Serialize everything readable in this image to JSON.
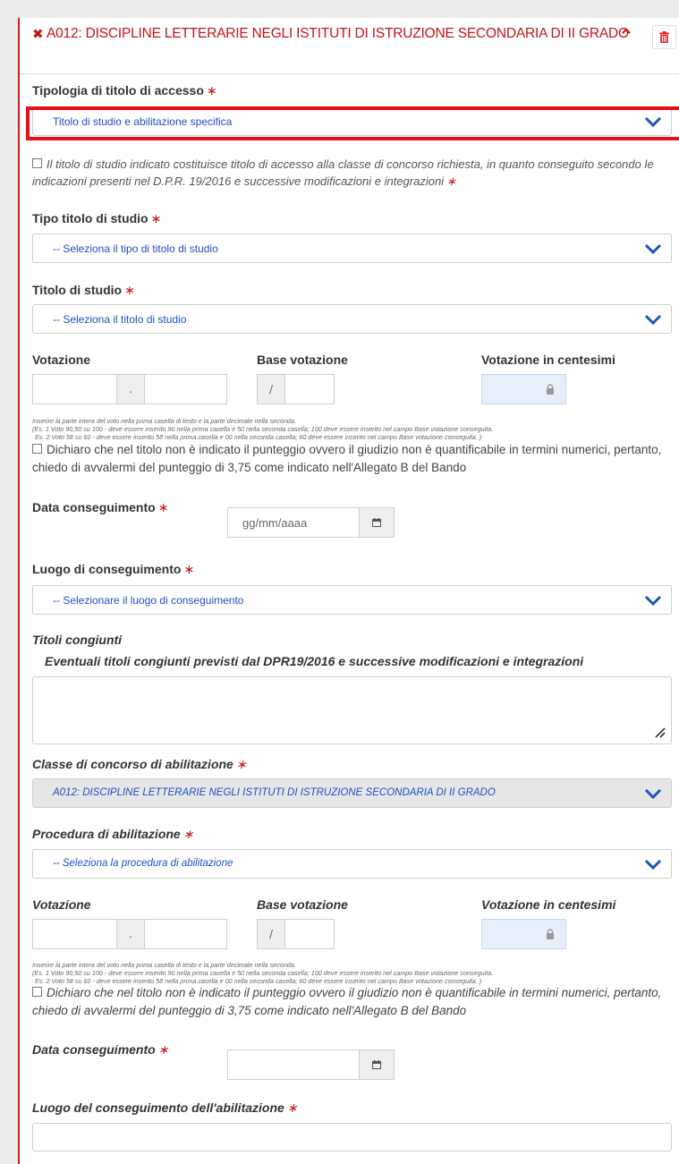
{
  "header": {
    "close_symbol": "✖",
    "title": "A012: DISCIPLINE LETTERARIE NEGLI ISTITUTI DI ISTRUZIONE SECONDARIA DI II GRADO"
  },
  "accesso": {
    "label": "Tipologia di titolo di accesso",
    "value": "Titolo di studio e abilitazione specifica"
  },
  "check1": "Il titolo di studio indicato costituisce titolo di accesso alla classe di concorso richiesta, in quanto conseguito secondo le indicazioni presenti nel D.P.R. 19/2016 e successive modificazioni e integrazioni",
  "tipo_titolo": {
    "label": "Tipo titolo di studio",
    "value": "-- Seleziona il tipo di titolo di studio"
  },
  "titolo": {
    "label": "Titolo di studio",
    "value": "-- Seleziona il titolo di studio"
  },
  "vote1": {
    "votazione": "Votazione",
    "base": "Base votazione",
    "centesimi": "Votazione in centesimi",
    "dot": ".",
    "slash": "/"
  },
  "help": [
    "Inserire la parte intera del voto nella prima casella di testo e la parte decimale nella seconda.",
    "(Es. 1 Voto 90,50 su 100 - deve essere inserito 90 nella prima casella e 50 nella seconda casella; 100 deve essere inserito nel campo Base votazione conseguita.",
    "Es. 2 Voto 58 su 60 - deve essere inserito 58 nella prima casella e 00 nella seconda casella; 60 deve essere inserito nel campo Base votazione conseguita. )"
  ],
  "check2": "Dichiaro che nel titolo non è indicato il punteggio ovvero il giudizio non è quantificabile in termini numerici, pertanto, chiedo di avvalermi del punteggio di 3,75 come indicato nell'Allegato B del Bando",
  "data1": {
    "label": "Data conseguimento",
    "placeholder": "gg/mm/aaaa"
  },
  "luogo1": {
    "label": "Luogo di conseguimento",
    "value": "-- Selezionare il luogo di conseguimento"
  },
  "congiunti": {
    "label": "Titoli congiunti",
    "sub": "Eventuali titoli congiunti previsti dal DPR19/2016 e successive modificazioni e integrazioni"
  },
  "classe": {
    "label": "Classe di concorso di abilitazione",
    "value": "A012: DISCIPLINE LETTERARIE NEGLI ISTITUTI DI ISTRUZIONE SECONDARIA DI II GRADO"
  },
  "procedura": {
    "label": "Procedura di abilitazione",
    "value": "-- Seleziona la procedura di abilitazione"
  },
  "vote2": {
    "votazione": "Votazione",
    "base": "Base votazione",
    "centesimi": "Votazione in centesimi",
    "dot": ".",
    "slash": "/"
  },
  "check3": "Dichiaro che nel titolo non è indicato il punteggio ovvero il giudizio non è quantificabile in termini numerici, pertanto, chiedo di avvalermi del punteggio di 3,75 come indicato nell'Allegato B del Bando",
  "data2": {
    "label": "Data conseguimento"
  },
  "luogo2": {
    "label": "Luogo del conseguimento dell'abilitazione"
  },
  "required_mark": "∗",
  "colors": {
    "accent_red": "#c0141b",
    "link_blue": "#1f4fc1",
    "chevron": "#1c56b8"
  },
  "icons": [
    "close-icon",
    "chevron-up-icon",
    "trash-icon",
    "chevron-down-icon",
    "lock-icon",
    "calendar-icon",
    "resize-handle-icon"
  ]
}
